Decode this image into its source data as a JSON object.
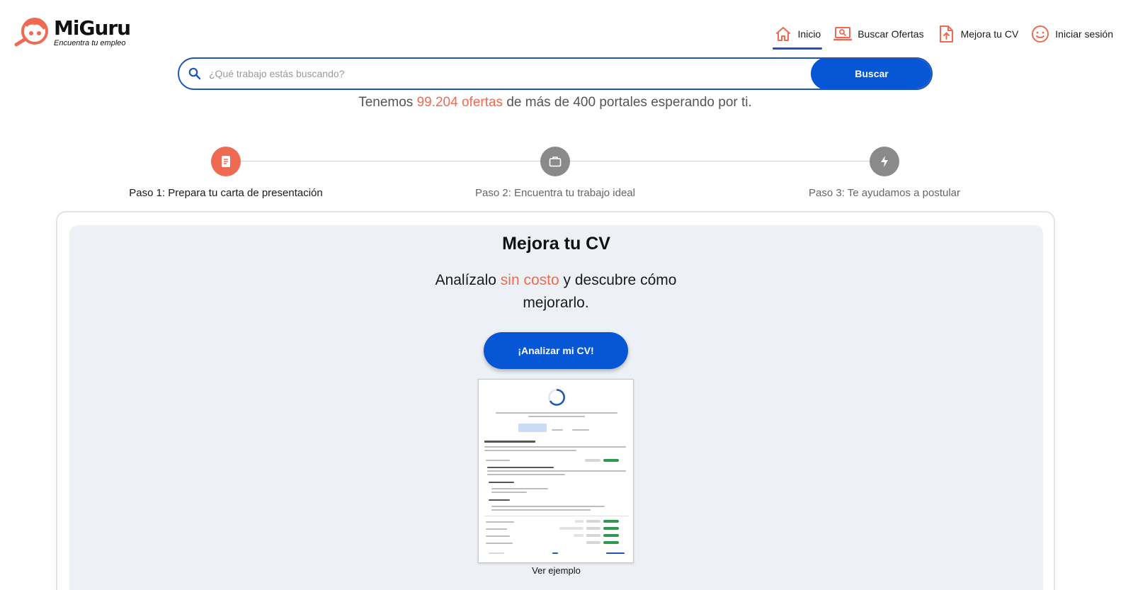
{
  "brand": {
    "name": "MiGuru",
    "tagline": "Encuentra tu empleo",
    "accent": "#ef6a52",
    "primary": "#0656d6"
  },
  "nav": {
    "items": [
      {
        "label": "Inicio",
        "icon": "home-icon",
        "active": true
      },
      {
        "label": "Buscar Ofertas",
        "icon": "laptop-search-icon",
        "active": false
      },
      {
        "label": "Mejora tu CV",
        "icon": "file-upload-icon",
        "active": false
      },
      {
        "label": "Iniciar sesión",
        "icon": "smiley-icon",
        "active": false
      }
    ]
  },
  "search": {
    "placeholder": "¿Qué trabajo estás buscando?",
    "button": "Buscar"
  },
  "tagline": {
    "prefix": "Tenemos",
    "highlight": "99.204 ofertas",
    "suffix": "de más de 400 portales esperando por ti."
  },
  "steps": [
    {
      "label": "Paso 1: Prepara tu carta de presentación",
      "icon": "document-icon",
      "active": true
    },
    {
      "label": "Paso 2: Encuentra tu trabajo ideal",
      "icon": "briefcase-icon",
      "active": false
    },
    {
      "label": "Paso 3: Te ayudamos a postular",
      "icon": "lightning-icon",
      "active": false
    }
  ],
  "cv_section": {
    "title": "Mejora tu CV",
    "subtitle_prefix": "Analízalo",
    "subtitle_highlight": "sin costo",
    "subtitle_suffix": "y descubre cómo mejorarlo.",
    "button": "¡Analizar mi CV!",
    "example_link": "Ver ejemplo"
  }
}
